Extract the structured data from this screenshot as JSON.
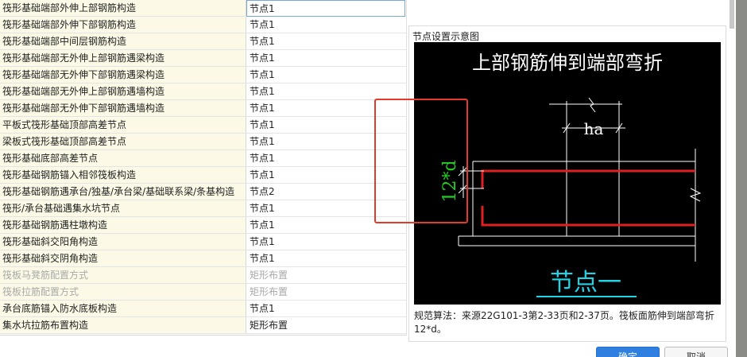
{
  "rows": [
    {
      "name": "筏形基础端部外伸上部钢筋构造",
      "value": "节点1"
    },
    {
      "name": "筏形基础端部外伸下部钢筋构造",
      "value": "节点1"
    },
    {
      "name": "筏形基础端部中间层钢筋构造",
      "value": "节点1"
    },
    {
      "name": "筏形基础端部无外伸上部钢筋遇梁构造",
      "value": "节点1"
    },
    {
      "name": "筏形基础端部无外伸下部钢筋遇梁构造",
      "value": "节点1"
    },
    {
      "name": "筏形基础端部无外伸上部钢筋遇墙构造",
      "value": "节点1"
    },
    {
      "name": "筏形基础端部无外伸下部钢筋遇墙构造",
      "value": "节点1"
    },
    {
      "name": "平板式筏形基础顶部高差节点",
      "value": "节点1"
    },
    {
      "name": "梁板式筏形基础顶部高差节点",
      "value": "节点1"
    },
    {
      "name": "筏形基础底部高差节点",
      "value": "节点1"
    },
    {
      "name": "筏形基础钢筋锚入相邻筏板构造",
      "value": "节点1"
    },
    {
      "name": "筏形基础钢筋遇承台/独基/承台梁/基础联系梁/条基构造",
      "value": "节点2"
    },
    {
      "name": "筏形/承台基础遇集水坑节点",
      "value": "节点1"
    },
    {
      "name": "筏形基础钢筋遇柱墩构造",
      "value": "节点1"
    },
    {
      "name": "筏形基础斜交阳角构造",
      "value": "节点1"
    },
    {
      "name": "筏形基础斜交阴角构造",
      "value": "节点1"
    },
    {
      "name": "筏板马凳筋配置方式",
      "value": "矩形布置"
    },
    {
      "name": "筏板拉筋配置方式",
      "value": "矩形布置"
    },
    {
      "name": "承台底筋锚入防水底板构造",
      "value": "节点1"
    },
    {
      "name": "集水坑拉筋布置构造",
      "value": "矩形布置"
    }
  ],
  "panel": {
    "title": "节点设置示意图",
    "diagram_title": "上部钢筋伸到端部弯折",
    "dim_ha": "ha",
    "dim_12d": "12*d",
    "node_label": "节点一",
    "description": "规范算法：来源22G101-3第2-33页和2-37页。筏板面筋伸到端部弯折12*d。"
  },
  "buttons": {
    "ok": "确定",
    "cancel": "取消"
  },
  "colors": {
    "name_bg": "#fcfae6",
    "highlight": "#e53a2a",
    "rebar": "#e02020",
    "dim_green": "#22cc22",
    "node_cyan": "#22d3e6",
    "accent": "#2f7fe0"
  }
}
